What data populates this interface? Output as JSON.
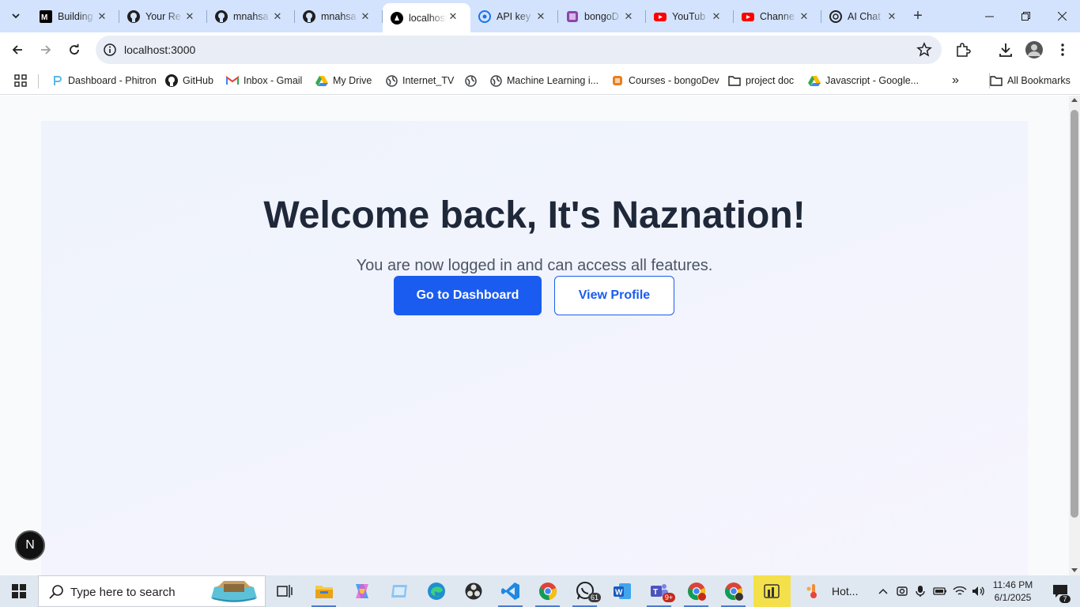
{
  "browser": {
    "tabs": [
      {
        "title": "Building",
        "icon": "medium-icon"
      },
      {
        "title": "Your Re",
        "icon": "github-icon"
      },
      {
        "title": "mnahsa",
        "icon": "github-icon"
      },
      {
        "title": "mnahsa",
        "icon": "github-icon"
      },
      {
        "title": "localhost",
        "icon": "nextjs-icon",
        "active": true
      },
      {
        "title": "API key",
        "icon": "api-icon"
      },
      {
        "title": "bongoD",
        "icon": "bongodev-icon"
      },
      {
        "title": "YouTub",
        "icon": "youtube-icon"
      },
      {
        "title": "Channe",
        "icon": "youtube-icon"
      },
      {
        "title": "AI Chat",
        "icon": "openai-icon"
      }
    ],
    "url": "localhost:3000",
    "bookmarks": [
      {
        "label": "Dashboard - Phitron",
        "icon": "phitron-icon"
      },
      {
        "label": "GitHub",
        "icon": "github-icon"
      },
      {
        "label": "Inbox - Gmail",
        "icon": "gmail-icon"
      },
      {
        "label": "My Drive",
        "icon": "drive-icon"
      },
      {
        "label": "Internet_TV",
        "icon": "globe-icon"
      },
      {
        "label": "",
        "icon": "globe-icon"
      },
      {
        "label": "Machine Learning i...",
        "icon": "globe-icon"
      },
      {
        "label": "Courses - bongoDev",
        "icon": "bongodev-icon"
      },
      {
        "label": "project doc",
        "icon": "folder-icon"
      },
      {
        "label": "Javascript - Google...",
        "icon": "drive-icon"
      }
    ],
    "all_bookmarks_label": "All Bookmarks"
  },
  "page": {
    "title": "Welcome back, It's Naznation!",
    "subtitle": "You are now logged in and can access all features.",
    "primary_button": "Go to Dashboard",
    "secondary_button": "View Profile",
    "dev_badge": "N"
  },
  "taskbar": {
    "search_placeholder": "Type here to search",
    "whatsapp_badge": "61",
    "teams_badge": "9+",
    "weather_text": "Hot...",
    "time": "11:46 PM",
    "date": "6/1/2025",
    "notification_count": "7"
  },
  "colors": {
    "accent": "#1a5cf0",
    "heading": "#1e2838",
    "tabstrip": "#d3e3fd"
  }
}
